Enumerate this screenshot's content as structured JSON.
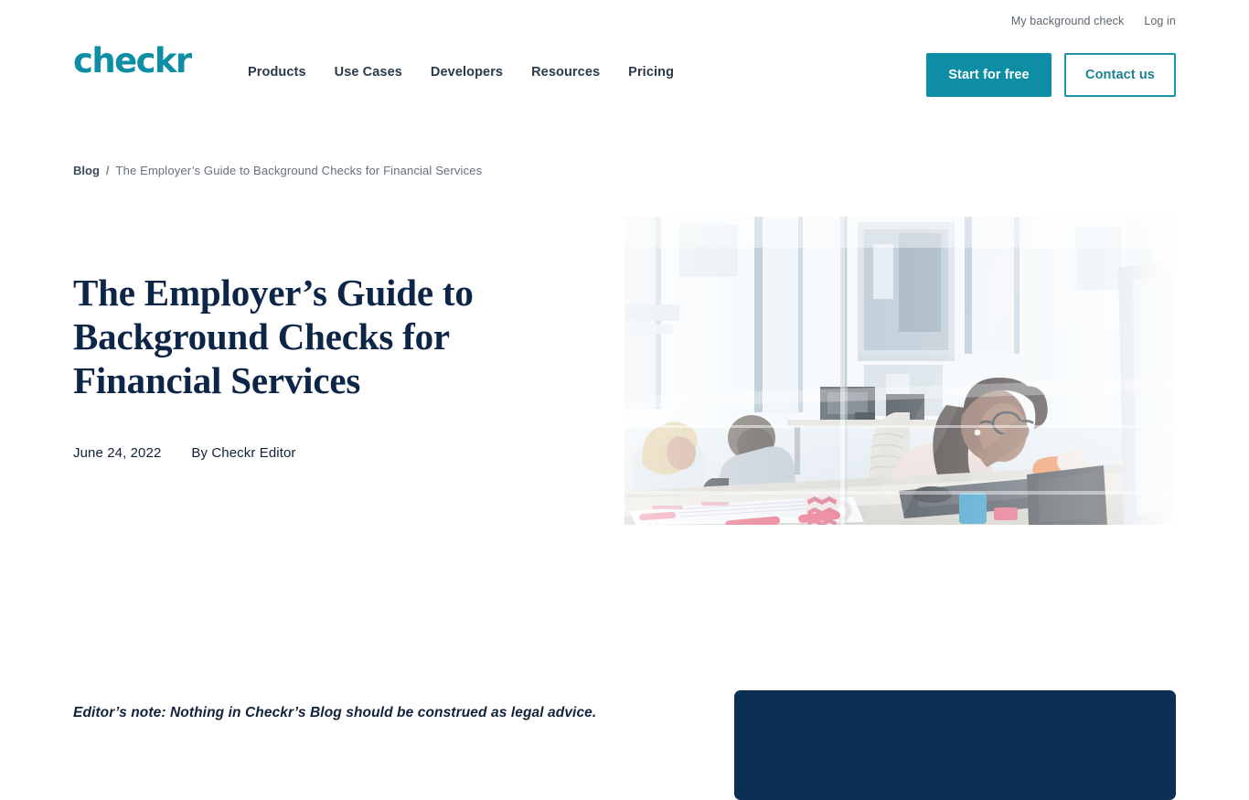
{
  "brand": {
    "logo_text": "checkr",
    "accent_color": "#0e8ea4",
    "navy_color": "#0d2546"
  },
  "utility_nav": {
    "items": [
      {
        "label": "My background check",
        "name": "my-background-check"
      },
      {
        "label": "Log in",
        "name": "log-in"
      }
    ]
  },
  "main_nav": {
    "items": [
      {
        "label": "Products"
      },
      {
        "label": "Use Cases"
      },
      {
        "label": "Developers"
      },
      {
        "label": "Resources"
      },
      {
        "label": "Pricing"
      }
    ]
  },
  "header_ctas": {
    "primary_label": "Start for free",
    "outline_label": "Contact us"
  },
  "breadcrumb": {
    "root": "Blog",
    "separator": "/",
    "current": "The Employer’s Guide to Background Checks for Financial Services"
  },
  "article": {
    "title": "The Employer’s Guide to Background Checks for Financial Services",
    "date": "June 24, 2022",
    "author": "By Checkr Editor",
    "hero_image_alt": "Woman with glasses working at an office desk with a computer, mug and papers, seen through a glass office partition"
  },
  "body": {
    "editor_note": "Editor’s note: Nothing in Checkr’s Blog should be construed as legal advice."
  }
}
